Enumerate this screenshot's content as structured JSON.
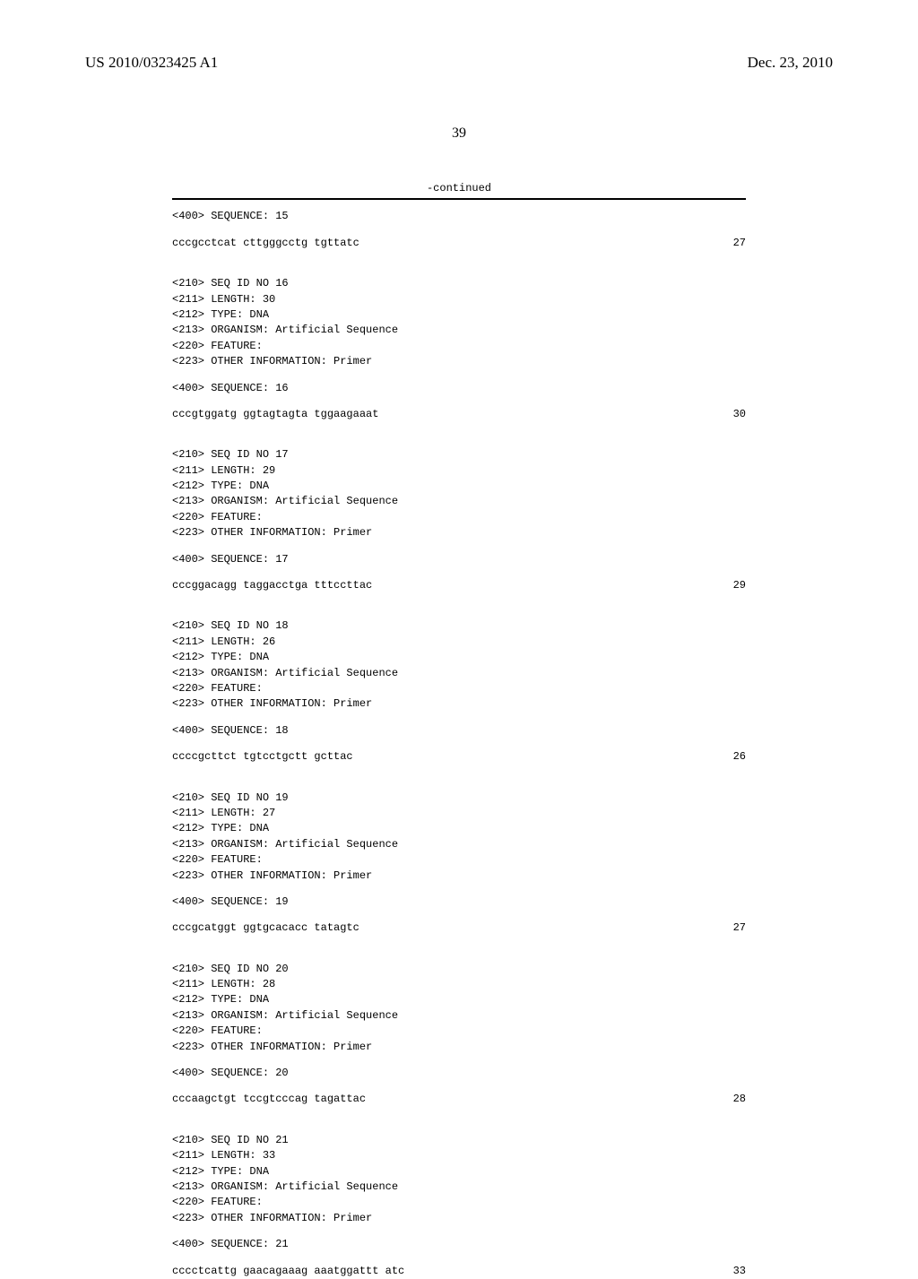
{
  "header": {
    "publication_number": "US 2010/0323425 A1",
    "date": "Dec. 23, 2010"
  },
  "page_number": "39",
  "continued_label": "-continued",
  "sequences": [
    {
      "seqhead": "<400> SEQUENCE: 15",
      "seqtext": "cccgcctcat cttgggcctg tgttatc",
      "seqlen": "27",
      "meta": null
    },
    {
      "seqhead": "<400> SEQUENCE: 16",
      "seqtext": "cccgtggatg ggtagtagta tggaagaaat",
      "seqlen": "30",
      "meta": [
        "<210> SEQ ID NO 16",
        "<211> LENGTH: 30",
        "<212> TYPE: DNA",
        "<213> ORGANISM: Artificial Sequence",
        "<220> FEATURE:",
        "<223> OTHER INFORMATION: Primer"
      ]
    },
    {
      "seqhead": "<400> SEQUENCE: 17",
      "seqtext": "cccggacagg taggacctga tttccttac",
      "seqlen": "29",
      "meta": [
        "<210> SEQ ID NO 17",
        "<211> LENGTH: 29",
        "<212> TYPE: DNA",
        "<213> ORGANISM: Artificial Sequence",
        "<220> FEATURE:",
        "<223> OTHER INFORMATION: Primer"
      ]
    },
    {
      "seqhead": "<400> SEQUENCE: 18",
      "seqtext": "ccccgcttct tgtcctgctt gcttac",
      "seqlen": "26",
      "meta": [
        "<210> SEQ ID NO 18",
        "<211> LENGTH: 26",
        "<212> TYPE: DNA",
        "<213> ORGANISM: Artificial Sequence",
        "<220> FEATURE:",
        "<223> OTHER INFORMATION: Primer"
      ]
    },
    {
      "seqhead": "<400> SEQUENCE: 19",
      "seqtext": "cccgcatggt ggtgcacacc tatagtc",
      "seqlen": "27",
      "meta": [
        "<210> SEQ ID NO 19",
        "<211> LENGTH: 27",
        "<212> TYPE: DNA",
        "<213> ORGANISM: Artificial Sequence",
        "<220> FEATURE:",
        "<223> OTHER INFORMATION: Primer"
      ]
    },
    {
      "seqhead": "<400> SEQUENCE: 20",
      "seqtext": "cccaagctgt tccgtcccag tagattac",
      "seqlen": "28",
      "meta": [
        "<210> SEQ ID NO 20",
        "<211> LENGTH: 28",
        "<212> TYPE: DNA",
        "<213> ORGANISM: Artificial Sequence",
        "<220> FEATURE:",
        "<223> OTHER INFORMATION: Primer"
      ]
    },
    {
      "seqhead": "<400> SEQUENCE: 21",
      "seqtext": "cccctcattg gaacagaaag aaatggattt atc",
      "seqlen": "33",
      "meta": [
        "<210> SEQ ID NO 21",
        "<211> LENGTH: 33",
        "<212> TYPE: DNA",
        "<213> ORGANISM: Artificial Sequence",
        "<220> FEATURE:",
        "<223> OTHER INFORMATION: Primer"
      ]
    }
  ]
}
